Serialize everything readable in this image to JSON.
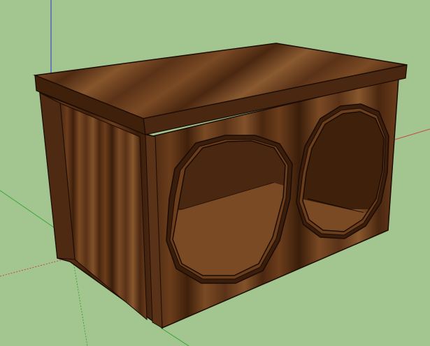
{
  "app": {
    "type": "3d-modeling-viewport",
    "background_color": "#a3c58f"
  },
  "axes": {
    "x_color": "#c44a4a",
    "y_color": "#3aa83a",
    "z_color": "#2f35c8"
  },
  "model": {
    "name": "subwoofer-box",
    "material": "dark-wood",
    "wood_base": "#5a3217",
    "wood_light": "#7a4a24",
    "wood_dark": "#3a1d0a",
    "edge_color": "#1a0c04",
    "port_count": 2
  }
}
